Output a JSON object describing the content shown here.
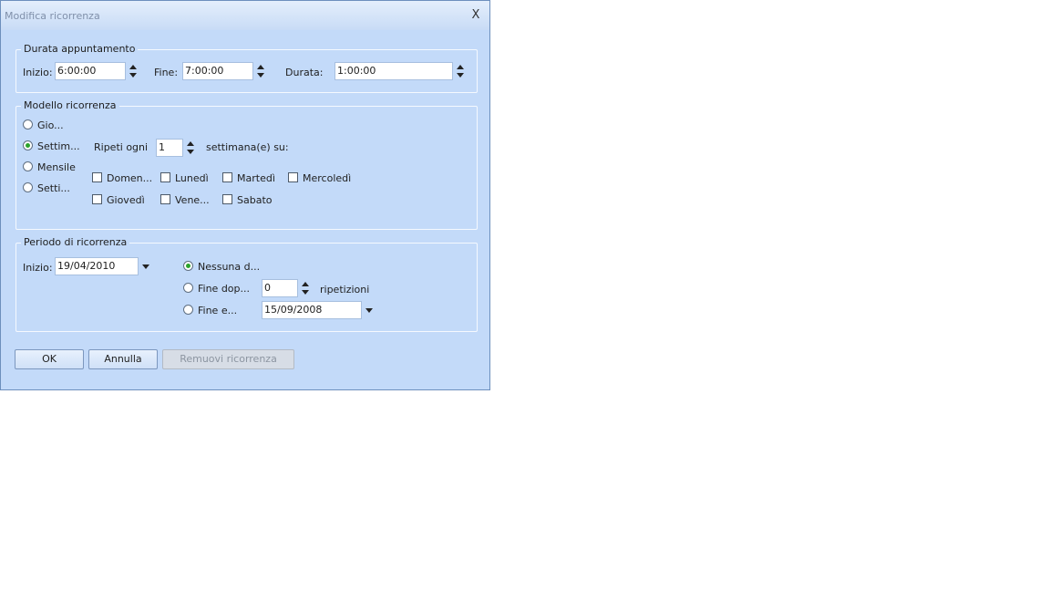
{
  "dialog": {
    "title": "Modifica ricorrenza",
    "close_glyph": "X"
  },
  "durata": {
    "legend": "Durata appuntamento",
    "inizio_label": "Inizio:",
    "inizio_value": "6:00:00",
    "fine_label": "Fine:",
    "fine_value": "7:00:00",
    "durata_label": "Durata:",
    "durata_value": "1:00:00"
  },
  "modello": {
    "legend": "Modello ricorrenza",
    "options": [
      {
        "label": "Gio...",
        "checked": false
      },
      {
        "label": "Settim...",
        "checked": true
      },
      {
        "label": "Mensile",
        "checked": false
      },
      {
        "label": "Setti...",
        "checked": false
      }
    ],
    "ripeti_label": "Ripeti ogni",
    "ripeti_value": "1",
    "settimane_label": "settimana(e) su:",
    "days": [
      {
        "label": "Domen...",
        "checked": false
      },
      {
        "label": "Lunedì",
        "checked": false
      },
      {
        "label": "Martedì",
        "checked": false
      },
      {
        "label": "Mercoledì",
        "checked": false
      },
      {
        "label": "Giovedì",
        "checked": false
      },
      {
        "label": "Vene...",
        "checked": false
      },
      {
        "label": "Sabato",
        "checked": false
      }
    ]
  },
  "periodo": {
    "legend": "Periodo di ricorrenza",
    "inizio_label": "Inizio:",
    "inizio_value": "19/04/2010",
    "nessuna_label": "Nessuna d...",
    "fine_dopo_label": "Fine dop...",
    "ripetizioni_value": "0",
    "ripetizioni_label": "ripetizioni",
    "fine_entro_label": "Fine e...",
    "fine_entro_value": "15/09/2008",
    "selected": "nessuna"
  },
  "buttons": {
    "ok": "OK",
    "annulla": "Annulla",
    "rimuovi": "Remuovi ricorrenza"
  },
  "colors": {
    "dialog_bg": "#c3daf9",
    "radio_selected": "#2ca42c"
  }
}
